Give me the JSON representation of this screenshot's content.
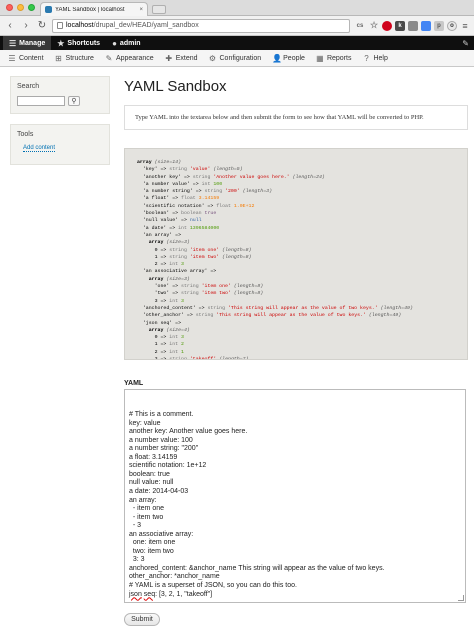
{
  "browser": {
    "tab_title": "YAML Sandbox | localhost",
    "tab_close": "×",
    "url_host": "localhost",
    "url_path": "/drupal_dev/HEAD/yaml_sandbox",
    "ext_cs": "cs",
    "ext_star": "☆",
    "ext_k": "k",
    "ext_p": "p",
    "ext_o": "o",
    "menu": "≡"
  },
  "admin_toolbar": {
    "manage": "Manage",
    "shortcuts": "Shortcuts",
    "user": "admin",
    "edit_icon": "✎"
  },
  "admin_menu": [
    {
      "label": "Content",
      "icon": "☰"
    },
    {
      "label": "Structure",
      "icon": "⊞"
    },
    {
      "label": "Appearance",
      "icon": "✎"
    },
    {
      "label": "Extend",
      "icon": "✚"
    },
    {
      "label": "Configuration",
      "icon": "⚙"
    },
    {
      "label": "People",
      "icon": "👤"
    },
    {
      "label": "Reports",
      "icon": "▦"
    },
    {
      "label": "Help",
      "icon": "?"
    }
  ],
  "sidebar": {
    "search_title": "Search",
    "search_button_icon": "⚲",
    "tools_title": "Tools",
    "tools_link": "Add content"
  },
  "main": {
    "title": "YAML Sandbox",
    "intro": "Type YAML into the textarea below and then submit the form to see how that YAML will be converted to PHP.",
    "yaml_label": "YAML",
    "submit_label": "Submit"
  },
  "dump_lines": [
    "array (size=14)",
    "  'key' => string 'value' (length=5)",
    "  'another key' => string 'Another value goes here.' (length=24)",
    "  'a number value' => int 100",
    "  'a number string' => string '200' (length=3)",
    "  'a float' => float 3.14159",
    "  'scientific notation' => float 1.0E+12",
    "  'boolean' => boolean true",
    "  'null value' => null",
    "  'a date' => int 1396584000",
    "  'an array' =>",
    "    array (size=3)",
    "      0 => string 'item one' (length=8)",
    "      1 => string 'item two' (length=8)",
    "      2 => int 3",
    "  'an associative array' =>",
    "    array (size=3)",
    "      'one' => string 'item one' (length=8)",
    "      'two' => string 'item two' (length=8)",
    "      3 => int 3",
    "  'anchored_content' => string 'This string will appear as the value of two keys.' (length=49)",
    "  'other_anchor' => string 'This string will appear as the value of two keys.' (length=49)",
    "  'json seq' =>",
    "    array (size=4)",
    "      0 => int 3",
    "      1 => int 2",
    "      2 => int 1",
    "      3 => string 'takeoff' (length=7)"
  ],
  "yaml_lines": [
    "# This is a comment.",
    "key: value",
    "another key: Another value goes here.",
    "a number value: 100",
    "a number string: \"200\"",
    "a float: 3.14159",
    "scientific notation: 1e+12",
    "boolean: true",
    "null value: null",
    "a date: 2014-04-03",
    "an array:",
    "  - item one",
    "  - item two",
    "  - 3",
    "an associative array:",
    "  one: item one",
    "  two: item two",
    "  3: 3",
    "anchored_content: &anchor_name This string will appear as the value of two keys.",
    "other_anchor: *anchor_name",
    "# YAML is a superset of JSON, so you can do this too.",
    "json seq: [3, 2, 1, \"takeoff\"]"
  ],
  "colors": {
    "toolbar": "#0f0f0f",
    "link": "#0071b3",
    "string_value": "#cc0000",
    "int_value": "#4e9a06",
    "float_value": "#f57900"
  }
}
